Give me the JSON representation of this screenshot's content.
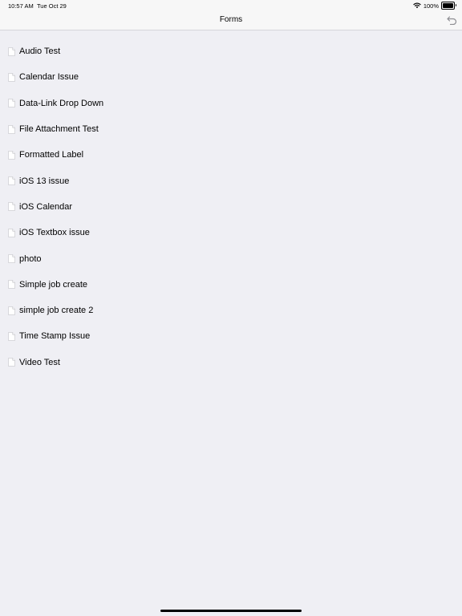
{
  "status_bar": {
    "time": "10:57 AM",
    "date": "Tue Oct 29",
    "battery_percent": "100%",
    "battery_level": 1.0,
    "icons": [
      "wifi-icon",
      "battery-icon"
    ]
  },
  "nav": {
    "title": "Forms",
    "back_icon": "back-arrow-icon"
  },
  "forms": {
    "item_icon": "document-icon",
    "items": [
      {
        "label": "Audio Test"
      },
      {
        "label": "Calendar Issue"
      },
      {
        "label": "Data-Link Drop Down"
      },
      {
        "label": "File Attachment Test"
      },
      {
        "label": "Formatted Label"
      },
      {
        "label": "iOS 13 issue"
      },
      {
        "label": "iOS Calendar"
      },
      {
        "label": "iOS Textbox issue"
      },
      {
        "label": "photo"
      },
      {
        "label": "Simple job create"
      },
      {
        "label": "simple job create 2"
      },
      {
        "label": "Time Stamp Issue"
      },
      {
        "label": "Video Test"
      }
    ]
  },
  "colors": {
    "background": "#efeff4",
    "bar": "#f7f7f7",
    "accent": "#8e8e93"
  }
}
